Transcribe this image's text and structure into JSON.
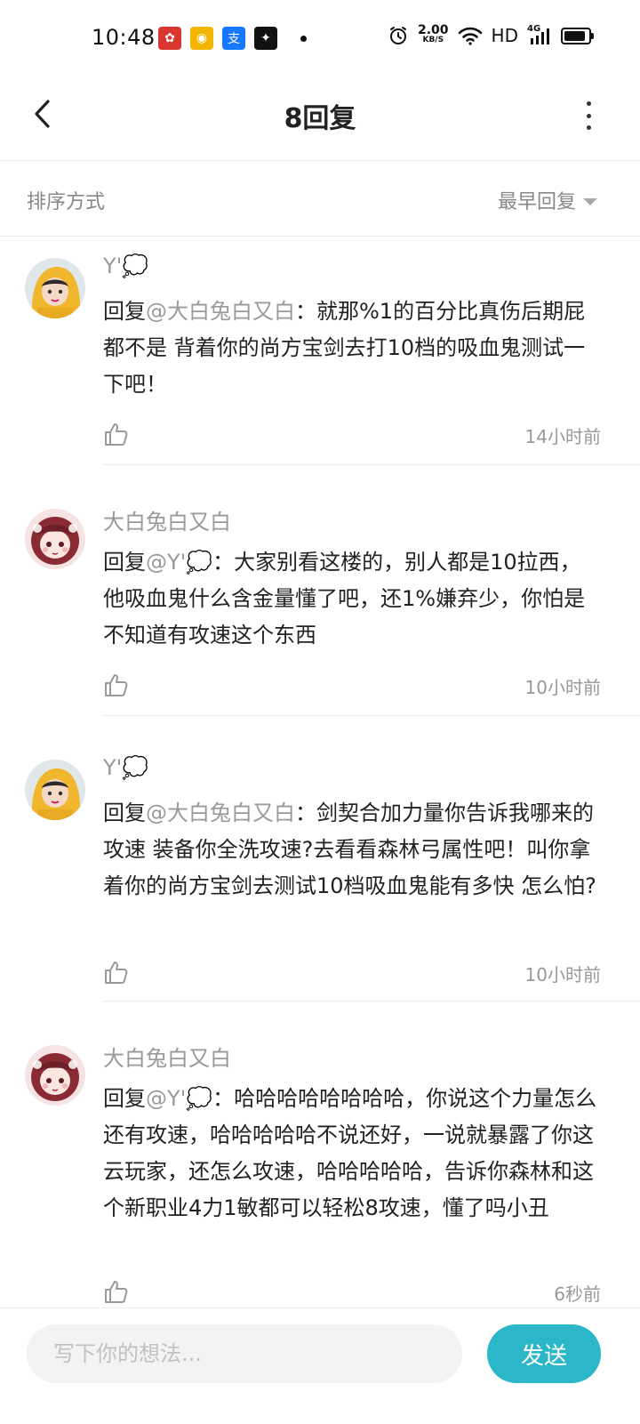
{
  "status_bar": {
    "time": "10:48",
    "net_speed_value": "2.00",
    "net_speed_unit": "KB/S",
    "hd_label": "HD",
    "signal_label": "4G",
    "apps": [
      {
        "name": "red-seal-app-icon",
        "color": "#d9362f",
        "glyph": "✿"
      },
      {
        "name": "yellow-app-icon",
        "color": "#f2b600",
        "glyph": "◉"
      },
      {
        "name": "alipay-icon",
        "color": "#1677ff",
        "glyph": "支"
      },
      {
        "name": "wechat-icon",
        "color": "#111111",
        "glyph": "✦"
      }
    ],
    "battery_level": 0.88
  },
  "header": {
    "title": "8回复"
  },
  "sort": {
    "label": "排序方式",
    "value": "最早回复"
  },
  "replies": [
    {
      "author": "Y'💭",
      "prefix": "回复",
      "mention": "@大白兔白又白",
      "text": "：就那%1的百分比真伤后期屁都不是 背着你的尚方宝剑去打10档的吸血鬼测试一下吧！",
      "time": "14小时前",
      "avatar": "yellow-hood"
    },
    {
      "author": "大白兔白又白",
      "prefix": "回复",
      "mention": "@Y'💭",
      "text": "：大家别看这楼的，别人都是10拉西，他吸血鬼什么含金量懂了吧，还1%嫌弃少，你怕是不知道有攻速这个东西",
      "time": "10小时前",
      "avatar": "pink-anime"
    },
    {
      "author": "Y'💭",
      "prefix": "回复",
      "mention": "@大白兔白又白",
      "text": "：剑契合加力量你告诉我哪来的攻速 装备你全洗攻速?去看看森林弓属性吧！叫你拿着你的尚方宝剑去测试10档吸血鬼能有多快 怎么怕?",
      "time": "10小时前",
      "avatar": "yellow-hood"
    },
    {
      "author": "大白兔白又白",
      "prefix": "回复",
      "mention": "@Y'💭",
      "text": "：哈哈哈哈哈哈哈哈，你说这个力量怎么还有攻速，哈哈哈哈哈不说还好，一说就暴露了你这云玩家，还怎么攻速，哈哈哈哈哈，告诉你森林和这个新职业4力1敏都可以轻松8攻速，懂了吗小丑",
      "time": "6秒前",
      "avatar": "pink-anime"
    }
  ],
  "composer": {
    "placeholder": "写下你的想法...",
    "send_label": "发送"
  }
}
